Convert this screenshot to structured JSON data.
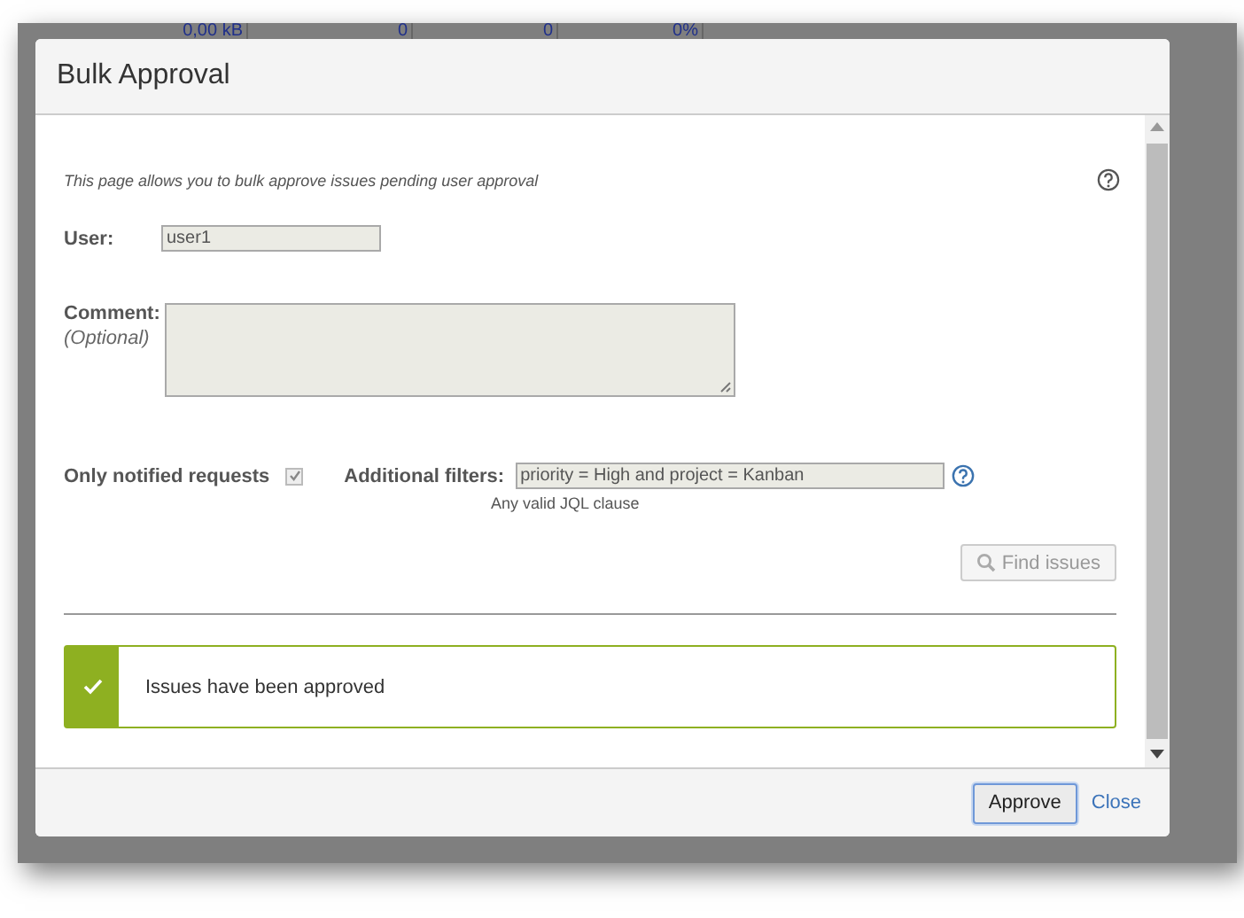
{
  "background_table": {
    "cells": [
      "0,00 kB",
      "0",
      "0",
      "0%"
    ]
  },
  "dialog": {
    "title": "Bulk Approval",
    "description": "This page allows you to bulk approve issues pending user approval",
    "user": {
      "label": "User:",
      "value": "user1"
    },
    "comment": {
      "label": "Comment:",
      "hint": "(Optional)"
    },
    "only_notified": {
      "label": "Only notified requests",
      "checked": true
    },
    "filters": {
      "label": "Additional filters:",
      "value": "priority = High and project = Kanban",
      "help": "Any valid JQL clause"
    },
    "find_button": {
      "label": "Find issues",
      "disabled": true
    },
    "message": {
      "kind": "success",
      "text": "Issues have been approved"
    },
    "buttons": {
      "approve": "Approve",
      "close": "Close"
    }
  }
}
